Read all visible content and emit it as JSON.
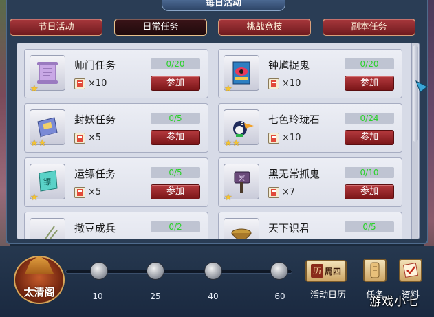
{
  "window": {
    "title": "每日活动"
  },
  "tabs": [
    {
      "label": "节日活动",
      "active": false
    },
    {
      "label": "日常任务",
      "active": true
    },
    {
      "label": "挑战竞技",
      "active": false
    },
    {
      "label": "副本任务",
      "active": false
    }
  ],
  "tasks": [
    {
      "name": "师门任务",
      "progress": "0/20",
      "reward": "×10",
      "stars": 1,
      "button": "参加",
      "icon": "scroll-icon"
    },
    {
      "name": "钟馗捉鬼",
      "progress": "0/20",
      "reward": "×10",
      "stars": 1,
      "button": "参加",
      "icon": "eye-banner-icon"
    },
    {
      "name": "封妖任务",
      "progress": "0/5",
      "reward": "×5",
      "stars": 2,
      "button": "参加",
      "icon": "book-icon"
    },
    {
      "name": "七色玲珑石",
      "progress": "0/24",
      "reward": "×10",
      "stars": 2,
      "button": "参加",
      "icon": "toucan-icon"
    },
    {
      "name": "运镖任务",
      "progress": "0/5",
      "reward": "×5",
      "stars": 1,
      "button": "参加",
      "icon": "escort-flag-icon"
    },
    {
      "name": "黑无常抓鬼",
      "progress": "0/10",
      "reward": "×7",
      "stars": 1,
      "button": "参加",
      "icon": "ghost-hammer-icon"
    },
    {
      "name": "撒豆成兵",
      "progress": "0/2",
      "reward": "",
      "stars": 0,
      "button": "",
      "icon": "beans-icon"
    },
    {
      "name": "天下识君",
      "progress": "0/5",
      "reward": "",
      "stars": 0,
      "button": "",
      "icon": "bowl-icon"
    }
  ],
  "bottom": {
    "building_label": "太清阁",
    "milestones": [
      "10",
      "25",
      "40",
      "60"
    ],
    "calendar": {
      "badge": "历",
      "day": "周四",
      "label": "活动日历"
    },
    "task_label": "任务",
    "gift_label": "资料"
  },
  "watermark": "游戏小七",
  "colors": {
    "progress_text": "#2bd12b",
    "button_red": "#9a2528",
    "tab_active": "#1f0a0c",
    "star": "#f5c531"
  }
}
